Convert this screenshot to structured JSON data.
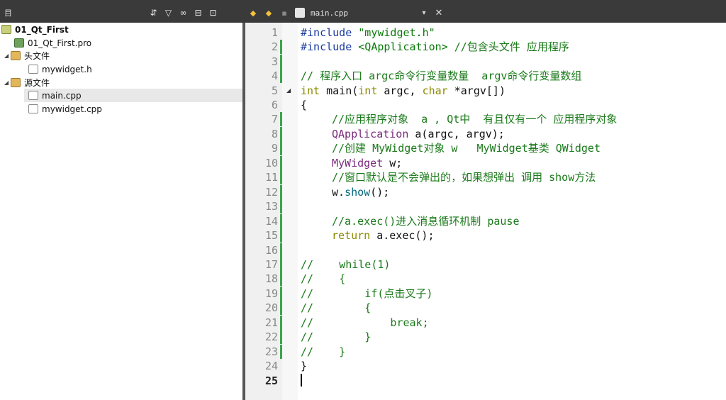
{
  "toolbar": {
    "left_label": "目",
    "tools": [
      {
        "name": "sync-icon",
        "glyph": "⇵"
      },
      {
        "name": "filter-icon",
        "glyph": "▽"
      },
      {
        "name": "link-icon",
        "glyph": "∞"
      },
      {
        "name": "split-icon",
        "glyph": "⊟"
      },
      {
        "name": "close-panel-icon",
        "glyph": "⊡"
      }
    ]
  },
  "tab": {
    "back_glyph": "◆",
    "forward_glyph": "◆",
    "file_name": "main.cpp",
    "dropdown_glyph": "▾",
    "close_glyph": "✕"
  },
  "project": {
    "root": "01_Qt_First",
    "pro_file": "01_Qt_First.pro",
    "headers_folder": "头文件",
    "header_file": "mywidget.h",
    "sources_folder": "源文件",
    "source_main": "main.cpp",
    "source_widget": "mywidget.cpp"
  },
  "editor": {
    "current_line": 25,
    "line_numbers": [
      "1",
      "2",
      "3",
      "4",
      "5",
      "6",
      "7",
      "8",
      "9",
      "10",
      "11",
      "12",
      "13",
      "14",
      "15",
      "16",
      "17",
      "18",
      "19",
      "20",
      "21",
      "22",
      "23",
      "24",
      "25"
    ],
    "lines": {
      "l1_kw": "#include",
      "l1_str": "\"mywidget.h\"",
      "l2_kw": "#include",
      "l2_str": "<QApplication>",
      "l2_cm": " //包含头文件 应用程序",
      "l4_cm": "// 程序入口 argc命令行变量数量  argv命令行变量数组",
      "l5_a": "int",
      "l5_b": " main(",
      "l5_c": "int",
      "l5_d": " argc, ",
      "l5_e": "char",
      "l5_f": " *argv[])",
      "l6": "{",
      "l7_cm": "//应用程序对象  a , Qt中  有且仅有一个 应用程序对象",
      "l8_ty": "QApplication",
      "l8_rest": " a(argc, argv);",
      "l9_cm": "//创建 MyWidget对象 w   MyWidget基类 QWidget",
      "l10_ty": "MyWidget",
      "l10_rest": " w;",
      "l11_cm": "//窗口默认是不会弹出的，如果想弹出 调用 show方法",
      "l12_a": "w.",
      "l12_b": "show",
      "l12_c": "();",
      "l14_cm": "//a.exec()进入消息循环机制 pause",
      "l15_kw": "return",
      "l15_rest": " a.exec();",
      "l17": "//    while(1)",
      "l18": "//    {",
      "l19": "//        if(点击叉子)",
      "l20": "//        {",
      "l21": "//            break;",
      "l22": "//        }",
      "l23": "//    }",
      "l24": "}"
    }
  }
}
